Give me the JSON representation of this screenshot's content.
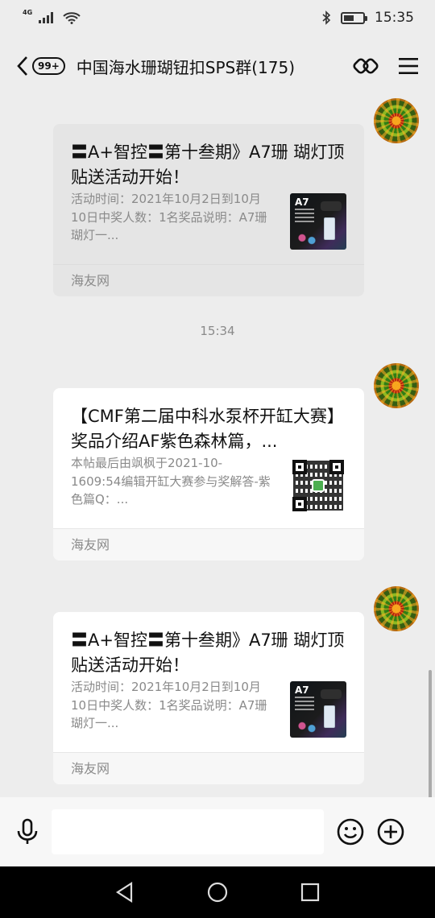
{
  "status_bar": {
    "network": "4G",
    "time": "15:35",
    "battery_level": 0.55
  },
  "top_bar": {
    "unread_badge": "99+",
    "title": "中国海水珊瑚钮扣SPS群(175)",
    "icons": [
      "back-arrow-icon",
      "group-link-icon",
      "menu-icon"
    ]
  },
  "messages": [
    {
      "type": "link_card",
      "style": "pressed",
      "title": "〓A+智控〓第十叁期》A7珊 瑚灯顶贴送活动开始！",
      "description": "活动时间：2021年10月2日到10月10日中奖人数：1名奖品说明：A7珊瑚灯一...",
      "thumbnail": "a7-lamp-image",
      "source": "海友网"
    },
    {
      "type": "timestamp",
      "text": "15:34"
    },
    {
      "type": "link_card",
      "style": "normal",
      "title": "【CMF第二届中科水泵杯开缸大赛】奖品介绍AF紫色森林篇，...",
      "description": "本帖最后由飒枫于2021-10-1609:54编辑开缸大赛参与奖解答-紫色篇Q：...",
      "thumbnail": "qr-code-image",
      "source": "海友网"
    },
    {
      "type": "link_card",
      "style": "normal",
      "title": "〓A+智控〓第十叁期》A7珊 瑚灯顶贴送活动开始！",
      "description": "活动时间：2021年10月2日到10月10日中奖人数：1名奖品说明：A7珊瑚灯一...",
      "thumbnail": "a7-lamp-image",
      "source": "海友网"
    }
  ],
  "thumbnail_text": {
    "a7": "A7"
  },
  "input_bar": {
    "message_value": "",
    "icons": [
      "microphone-icon",
      "emoji-icon",
      "plus-icon"
    ]
  },
  "nav_bar": {
    "icons": [
      "back-triangle-icon",
      "home-circle-icon",
      "recents-square-icon"
    ]
  }
}
